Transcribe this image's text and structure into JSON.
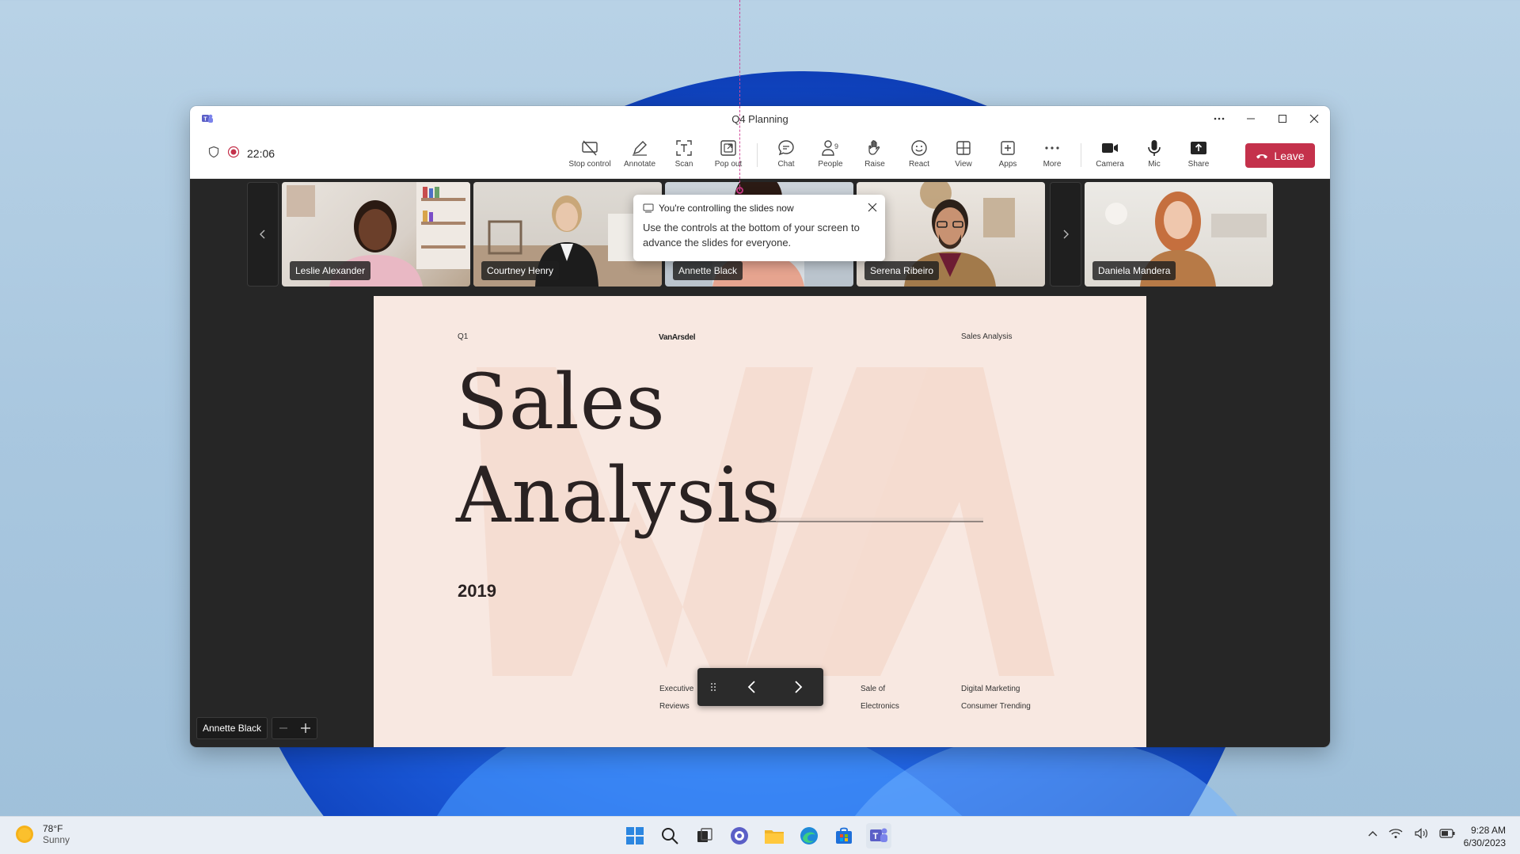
{
  "window": {
    "title": "Q4 Planning"
  },
  "toolbar": {
    "timer": "22:06",
    "tools": [
      {
        "label": "Stop control",
        "icon": "stop-control-icon"
      },
      {
        "label": "Annotate",
        "icon": "annotate-icon"
      },
      {
        "label": "Scan",
        "icon": "scan-icon"
      },
      {
        "label": "Pop out",
        "icon": "pop-out-icon"
      },
      {
        "label": "Chat",
        "icon": "chat-icon"
      },
      {
        "label": "People",
        "icon": "people-icon"
      },
      {
        "label": "Raise",
        "icon": "raise-hand-icon"
      },
      {
        "label": "React",
        "icon": "react-icon"
      },
      {
        "label": "View",
        "icon": "view-icon"
      },
      {
        "label": "Apps",
        "icon": "apps-icon"
      },
      {
        "label": "More",
        "icon": "more-icon"
      },
      {
        "label": "Camera",
        "icon": "camera-icon"
      },
      {
        "label": "Mic",
        "icon": "mic-icon"
      },
      {
        "label": "Share",
        "icon": "share-icon"
      }
    ],
    "people_count": "9",
    "leave_label": "Leave"
  },
  "participants": [
    {
      "name": "Leslie Alexander"
    },
    {
      "name": "Courtney Henry"
    },
    {
      "name": "Annette Black"
    },
    {
      "name": "Serena Ribeiro"
    },
    {
      "name": "Daniela Mandera"
    }
  ],
  "callout": {
    "title": "You're controlling the slides now",
    "body": "Use the controls at the bottom of your screen to advance the slides for everyone."
  },
  "slide": {
    "corner_left": "Q1",
    "brand": "VanArsdel",
    "corner_right": "Sales Analysis",
    "title_line1": "Sales",
    "title_line2": "Analysis",
    "year": "2019",
    "labels": [
      {
        "l1": "Executive",
        "l2": "Reviews"
      },
      {
        "l1": "Sale of",
        "l2": "Electronics"
      },
      {
        "l1": "Digital Marketing",
        "l2": "Consumer  Trending"
      }
    ]
  },
  "presenter": {
    "name": "Annette Black"
  },
  "taskbar": {
    "weather_temp": "78°F",
    "weather_desc": "Sunny",
    "time": "9:28 AM",
    "date": "6/30/2023"
  },
  "colors": {
    "leave": "#c4314b",
    "slide_bg": "#f8e8e1",
    "stage_bg": "#262626"
  }
}
